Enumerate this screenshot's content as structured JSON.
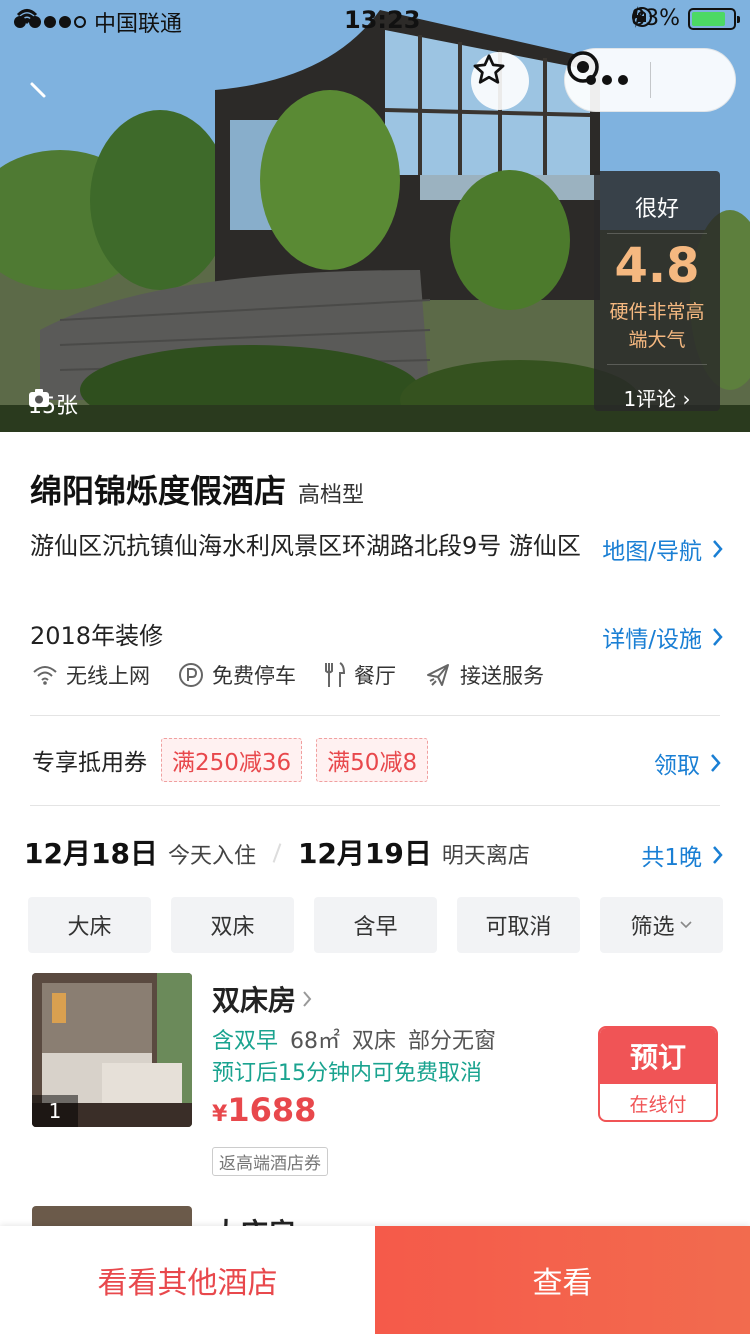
{
  "status_bar": {
    "carrier": "中国联通",
    "time": "13:23",
    "battery": "83%"
  },
  "hero": {
    "photo_count": "15张",
    "rating": {
      "level": "很好",
      "score": "4.8",
      "comment": "硬件非常高端大气",
      "reviews": "1评论"
    }
  },
  "hotel": {
    "name": "绵阳锦烁度假酒店",
    "type": "高档型",
    "address": "游仙区沉抗镇仙海水利风景区环湖路北段9号 游仙区",
    "map_link": "地图/导航",
    "renovation": "2018年装修",
    "detail_link": "详情/设施",
    "amenities": [
      {
        "label": "无线上网",
        "icon": "wifi-icon"
      },
      {
        "label": "免费停车",
        "icon": "parking-icon"
      },
      {
        "label": "餐厅",
        "icon": "restaurant-icon"
      },
      {
        "label": "接送服务",
        "icon": "plane-icon"
      }
    ]
  },
  "coupons": {
    "label": "专享抵用券",
    "items": [
      "满250减36",
      "满50减8"
    ],
    "claim": "领取"
  },
  "dates": {
    "checkin_date": "12月18日",
    "checkin_label": "今天入住",
    "checkout_date": "12月19日",
    "checkout_label": "明天离店",
    "nights": "共1晚"
  },
  "filters": [
    "大床",
    "双床",
    "含早",
    "可取消",
    "筛选"
  ],
  "rooms": [
    {
      "name": "双床房",
      "image_index": "1",
      "breakfast": "含双早",
      "area": "68㎡",
      "bed": "双床",
      "window": "部分无窗",
      "cancel": "预订后15分钟内可免费取消",
      "currency": "¥",
      "price": "1688",
      "tag": "返高端酒店券",
      "book": "预订",
      "pay": "在线付"
    },
    {
      "name": "大床房"
    }
  ],
  "bottom": {
    "other_hotels": "看看其他酒店",
    "view": "查看"
  },
  "colors": {
    "accent_red": "#f05456",
    "link_blue": "#1a7fd4",
    "teal": "#1aa38f",
    "rating_gold": "#f5b880"
  }
}
